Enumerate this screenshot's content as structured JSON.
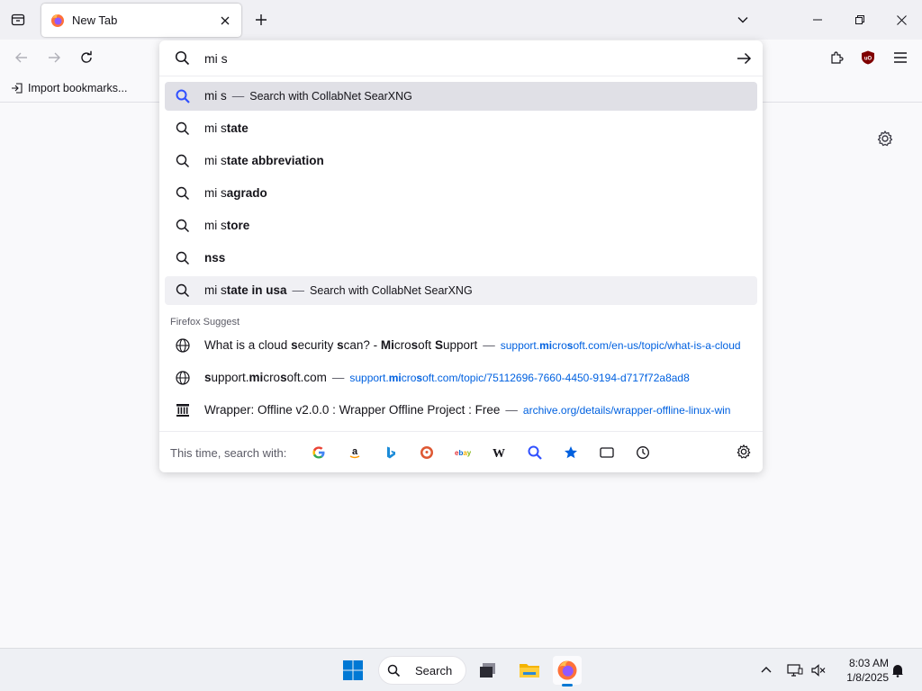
{
  "tab": {
    "title": "New Tab"
  },
  "bookmarks": {
    "import_label": "Import bookmarks..."
  },
  "urlbar": {
    "value": "mi s",
    "results": [
      {
        "type": "search",
        "parts": [
          {
            "t": "mi s",
            "b": false
          }
        ],
        "action": "Search with CollabNet SearXNG"
      },
      {
        "type": "search",
        "parts": [
          {
            "t": "mi s",
            "b": false
          },
          {
            "t": "tate",
            "b": true
          }
        ]
      },
      {
        "type": "search",
        "parts": [
          {
            "t": "mi s",
            "b": false
          },
          {
            "t": "tate abbreviation",
            "b": true
          }
        ]
      },
      {
        "type": "search",
        "parts": [
          {
            "t": "mi s",
            "b": false
          },
          {
            "t": "agrado",
            "b": true
          }
        ]
      },
      {
        "type": "search",
        "parts": [
          {
            "t": "mi s",
            "b": false
          },
          {
            "t": "tore",
            "b": true
          }
        ]
      },
      {
        "type": "search",
        "parts": [
          {
            "t": "nss",
            "b": true
          }
        ]
      },
      {
        "type": "search",
        "parts": [
          {
            "t": "mi s",
            "b": false
          },
          {
            "t": "tate in usa",
            "b": true
          }
        ],
        "action": "Search with CollabNet SearXNG"
      }
    ],
    "suggest_label": "Firefox Suggest",
    "suggest": [
      {
        "icon": "globe-icon",
        "parts": [
          {
            "t": "What ",
            "b": false
          },
          {
            "t": "is",
            "b": false
          },
          {
            "t": " a cloud ",
            "b": false
          },
          {
            "t": "s",
            "b": true
          },
          {
            "t": "ecurity ",
            "b": false
          },
          {
            "t": "s",
            "b": true
          },
          {
            "t": "can? - ",
            "b": false
          },
          {
            "t": "Mi",
            "b": true
          },
          {
            "t": "cro",
            "b": false
          },
          {
            "t": "s",
            "b": true
          },
          {
            "t": "oft ",
            "b": false
          },
          {
            "t": "S",
            "b": true
          },
          {
            "t": "upport",
            "b": false
          }
        ],
        "url_parts": [
          {
            "t": "support.",
            "b": false
          },
          {
            "t": "mi",
            "b": true
          },
          {
            "t": "cro",
            "b": false
          },
          {
            "t": "s",
            "b": true
          },
          {
            "t": "oft.com/en-us/topic/what-is-a-cloud",
            "b": false
          }
        ]
      },
      {
        "icon": "globe-icon",
        "parts": [
          {
            "t": "s",
            "b": true
          },
          {
            "t": "upport.",
            "b": false
          },
          {
            "t": "mi",
            "b": true
          },
          {
            "t": "cro",
            "b": false
          },
          {
            "t": "s",
            "b": true
          },
          {
            "t": "oft.com",
            "b": false
          }
        ],
        "url_parts": [
          {
            "t": "support.",
            "b": false
          },
          {
            "t": "mi",
            "b": true
          },
          {
            "t": "cro",
            "b": false
          },
          {
            "t": "s",
            "b": true
          },
          {
            "t": "oft.com/topic/75112696-7660-4450-9194-d717f72a8ad8",
            "b": false
          }
        ]
      },
      {
        "icon": "archive-icon",
        "parts": [
          {
            "t": "Wrapper: Offline v2.0.0 : Wrapper Offline Project : Free",
            "b": false
          }
        ],
        "url_parts": [
          {
            "t": "archive.org/details/wrapper-offline-linux-win",
            "b": false
          }
        ]
      }
    ],
    "oneoff_label": "This time, search with:",
    "engines": [
      "google-icon",
      "amazon-icon",
      "bing-icon",
      "duckduckgo-icon",
      "ebay-icon",
      "wikipedia-icon",
      "searxng-icon",
      "bookmarks-icon",
      "tabs-icon",
      "history-icon"
    ]
  },
  "taskbar": {
    "search_label": "Search",
    "time": "8:03 AM",
    "date": "1/8/2025"
  }
}
